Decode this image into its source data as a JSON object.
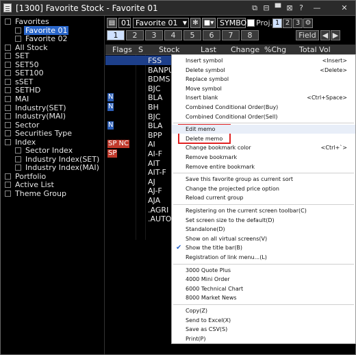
{
  "window": {
    "title": "[1300] Favorite Stock - Favorite 01",
    "controls": [
      "⧉",
      "⊟",
      "▀",
      "⊠",
      "?",
      "—",
      "✕"
    ]
  },
  "tree": [
    {
      "label": "Favorites",
      "level": 0
    },
    {
      "label": "Favorite 01",
      "level": 1,
      "selected": true
    },
    {
      "label": "Favorite 02",
      "level": 1
    },
    {
      "label": "All Stock",
      "level": 0
    },
    {
      "label": "SET",
      "level": 0
    },
    {
      "label": "SET50",
      "level": 0
    },
    {
      "label": "SET100",
      "level": 0
    },
    {
      "label": "sSET",
      "level": 0
    },
    {
      "label": "SETHD",
      "level": 0
    },
    {
      "label": "MAI",
      "level": 0
    },
    {
      "label": "Industry(SET)",
      "level": 0
    },
    {
      "label": "Industry(MAI)",
      "level": 0
    },
    {
      "label": "Sector",
      "level": 0
    },
    {
      "label": "Securities Type",
      "level": 0
    },
    {
      "label": "Index",
      "level": 0
    },
    {
      "label": "Sector Index",
      "level": 1
    },
    {
      "label": "Industry Index(SET)",
      "level": 1
    },
    {
      "label": "Industry Index(MAI)",
      "level": 1
    },
    {
      "label": "Portfolio",
      "level": 0
    },
    {
      "label": "Active List",
      "level": 0
    },
    {
      "label": "Theme Group",
      "level": 0
    }
  ],
  "toolbar": {
    "group_number": "01",
    "group_name": "Favorite 01",
    "search_value": "SYMBOL",
    "proj_label": "Proj.",
    "num_buttons": [
      "1",
      "2",
      "3"
    ],
    "pages": [
      "1",
      "2",
      "3",
      "4",
      "5",
      "6",
      "7",
      "8"
    ],
    "field_label": "Field"
  },
  "grid": {
    "headers": [
      "Flags",
      "S",
      "Stock",
      "Last",
      "Change",
      "%Chg",
      "Total Vol"
    ],
    "rows": [
      {
        "flag": "",
        "stock": "FSS"
      },
      {
        "flag": "",
        "stock": "BANPU"
      },
      {
        "flag": "",
        "stock": "BDMS"
      },
      {
        "flag": "",
        "stock": "BJC"
      },
      {
        "flag": "N",
        "stock": "BLA"
      },
      {
        "flag": "N",
        "stock": "BH"
      },
      {
        "flag": "",
        "stock": "BJC"
      },
      {
        "flag": "N",
        "stock": "BLA"
      },
      {
        "flag": "",
        "stock": "BPP"
      },
      {
        "flag": "SP NC",
        "stock": "AI"
      },
      {
        "flag": "SP",
        "stock": "AI-F"
      },
      {
        "flag": "",
        "stock": "AIT"
      },
      {
        "flag": "",
        "stock": "AIT-F"
      },
      {
        "flag": "",
        "stock": "AJ"
      },
      {
        "flag": "",
        "stock": "AJ-F"
      },
      {
        "flag": "",
        "stock": "AJA"
      },
      {
        "flag": "",
        "stock": ".AGRI"
      },
      {
        "flag": "",
        "stock": ".AUTO"
      }
    ]
  },
  "menu": [
    {
      "label": "Insert symbol",
      "shortcut": "<Insert>"
    },
    {
      "label": "Delete symbol",
      "shortcut": "<Delete>"
    },
    {
      "label": "Replace symbol",
      "shortcut": ""
    },
    {
      "label": "Move symbol",
      "shortcut": ""
    },
    {
      "label": "Insert blank",
      "shortcut": "<Ctrl+Space>"
    },
    {
      "label": "Combined Conditional Order(Buy)",
      "shortcut": ""
    },
    {
      "label": "Combined Conditional Order(Sell)",
      "shortcut": ""
    },
    {
      "sep": true
    },
    {
      "label": "Edit memo",
      "shortcut": "",
      "hover": true
    },
    {
      "label": "Delete memo",
      "shortcut": ""
    },
    {
      "label": "Change bookmark color",
      "shortcut": "<Ctrl+`>"
    },
    {
      "label": "Remove bookmark",
      "shortcut": ""
    },
    {
      "label": "Remove entire bookmark",
      "shortcut": ""
    },
    {
      "sep": true
    },
    {
      "label": "Save this favorite group as current sort",
      "shortcut": ""
    },
    {
      "label": "Change the projected price option",
      "shortcut": ""
    },
    {
      "label": "Reload current group",
      "shortcut": ""
    },
    {
      "sep": true
    },
    {
      "label": "Registering on the current screen toolbar(C)",
      "shortcut": ""
    },
    {
      "label": "Set screen size to the default(D)",
      "shortcut": ""
    },
    {
      "label": "Standalone(D)",
      "shortcut": ""
    },
    {
      "label": "Show on all virtual screens(V)",
      "shortcut": ""
    },
    {
      "label": "Show the title bar(B)",
      "shortcut": "",
      "checked": true
    },
    {
      "label": "Registration of link menu...(L)",
      "shortcut": ""
    },
    {
      "sep": true
    },
    {
      "label": "3000 Quote Plus",
      "shortcut": ""
    },
    {
      "label": "4000 Mini Order",
      "shortcut": ""
    },
    {
      "label": "6000 Technical Chart",
      "shortcut": ""
    },
    {
      "label": "8000 Market News",
      "shortcut": ""
    },
    {
      "sep": true
    },
    {
      "label": "Copy(Z)",
      "shortcut": ""
    },
    {
      "label": "Send to Excel(X)",
      "shortcut": ""
    },
    {
      "label": "Save as CSV(S)",
      "shortcut": ""
    },
    {
      "label": "Print(P)",
      "shortcut": ""
    }
  ]
}
